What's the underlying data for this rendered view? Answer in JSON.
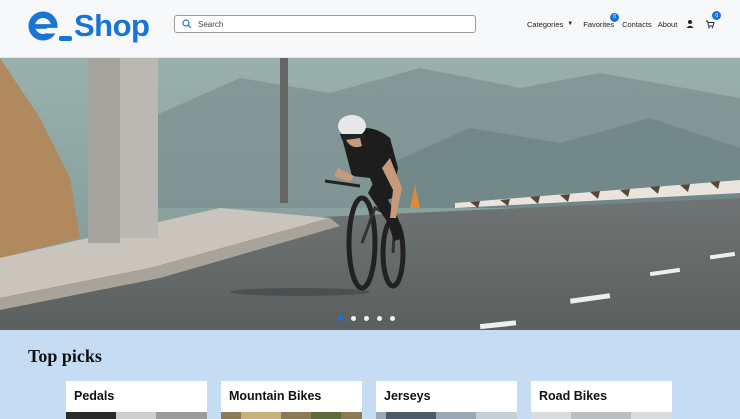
{
  "header": {
    "logo_prefix": "e",
    "logo_text": "Shop",
    "search": {
      "placeholder": "Search",
      "value": ""
    },
    "nav": {
      "categories_label": "Categories",
      "favorites_label": "Favorites",
      "favorites_count": "0",
      "contacts_label": "Contacts",
      "about_label": "About",
      "cart_count": "0"
    }
  },
  "hero": {
    "slide_count": 5,
    "active_slide": 1
  },
  "top_picks": {
    "title": "Top picks",
    "cards": [
      {
        "label": "Pedals"
      },
      {
        "label": "Mountain Bikes"
      },
      {
        "label": "Jerseys"
      },
      {
        "label": "Road Bikes"
      }
    ]
  },
  "colors": {
    "brand": "#1a73d9",
    "picks_background": "#c6dcf2"
  },
  "icons": [
    "search-icon",
    "user-icon",
    "cart-icon",
    "chevron-down-icon"
  ]
}
